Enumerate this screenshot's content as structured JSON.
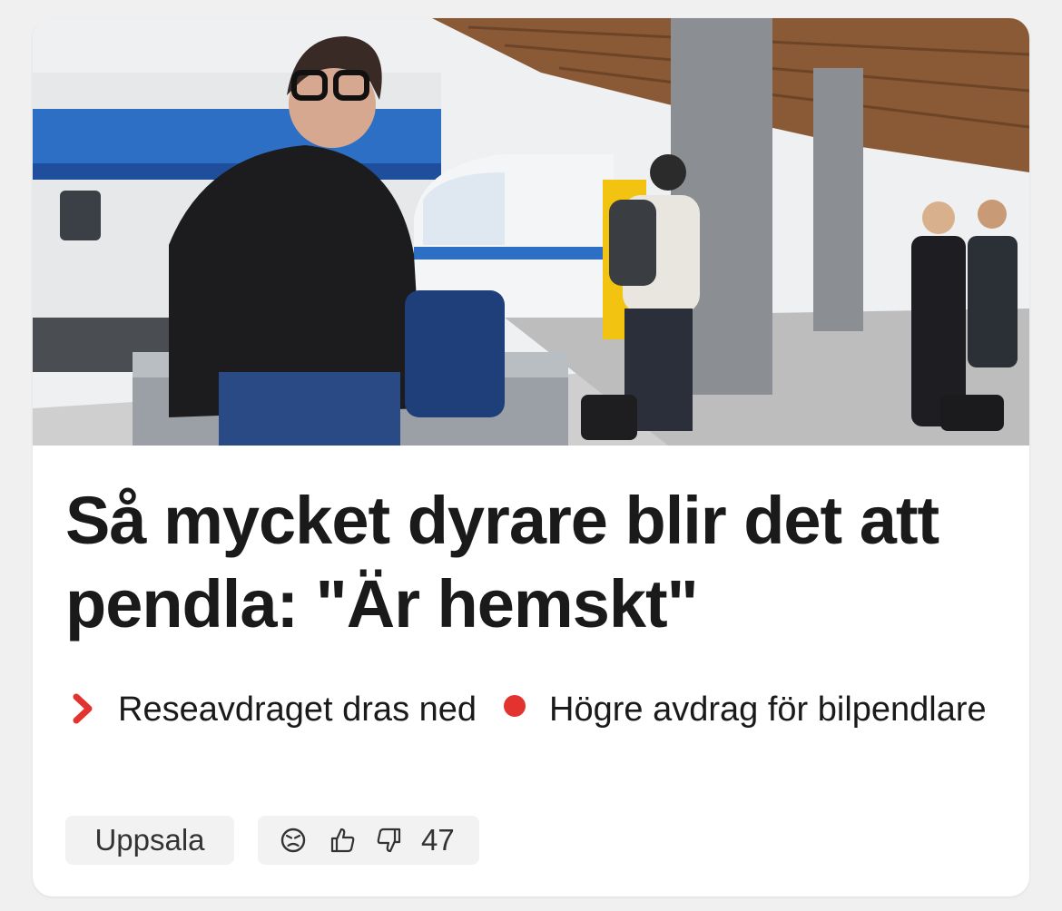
{
  "article": {
    "headline": "Så mycket dyrare blir det att pendla: \"Är hemskt\"",
    "lead_item_1": "Reseavdraget dras ned",
    "lead_item_2": "Högre avdrag för bilpendlare",
    "location_tag": "Uppsala",
    "reaction_count": "47",
    "image_description_icon": "photo-train-platform"
  },
  "colors": {
    "accent": "#e3332f",
    "text": "#1a1a1a",
    "tag_bg": "#f2f2f2",
    "page_bg": "#f0f0f0"
  }
}
